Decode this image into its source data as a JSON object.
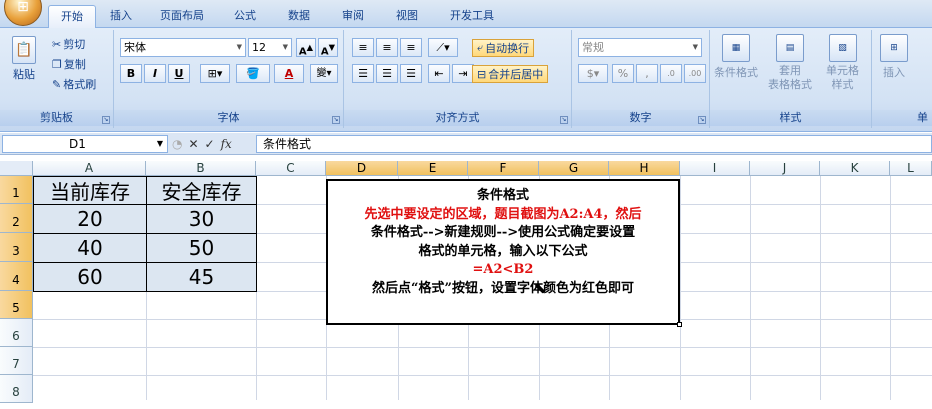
{
  "ribbon_tabs": [
    "开始",
    "插入",
    "页面布局",
    "公式",
    "数据",
    "审阅",
    "视图",
    "开发工具"
  ],
  "clipboard": {
    "paste": "粘贴",
    "cut": "剪切",
    "copy": "复制",
    "format_painter": "格式刷",
    "label": "剪贴板"
  },
  "font": {
    "name": "宋体",
    "size": "12",
    "bold": "B",
    "italic": "I",
    "underline": "U",
    "label": "字体"
  },
  "alignment": {
    "wrap": "自动换行",
    "merge": "合并后居中",
    "label": "对齐方式"
  },
  "number": {
    "format": "常规",
    "label": "数字"
  },
  "styles": {
    "conditional": "条件格式",
    "as_table": "套用\n表格格式",
    "cell_styles": "单元格\n样式",
    "label": "样式"
  },
  "cells": {
    "insert": "插入",
    "label": "单"
  },
  "formula_bar": {
    "name_box": "D1",
    "content": "条件格式",
    "fx": "fx"
  },
  "columns": [
    "A",
    "B",
    "C",
    "D",
    "E",
    "F",
    "G",
    "H",
    "I",
    "J",
    "K",
    "L"
  ],
  "rows": [
    "1",
    "2",
    "3",
    "4",
    "5",
    "6",
    "7",
    "8"
  ],
  "table": {
    "headers": [
      "当前库存",
      "安全库存"
    ],
    "rows": [
      [
        "20",
        "30"
      ],
      [
        "40",
        "50"
      ],
      [
        "60",
        "45"
      ]
    ]
  },
  "note": {
    "title": "条件格式",
    "line1": "先选中要设定的区域，题目截图为A2:A4，然后",
    "line2": "条件格式-->新建规则-->使用公式确定要设置",
    "line3": "格式的单元格，输入以下公式",
    "line4": "=A2<B2",
    "line5": "然后点“格式”按钮，设置字体颜色为红色即可"
  },
  "colors": {
    "accent_red": "#e01010",
    "table_fill": "#dce6f1",
    "selected_header": "#f1c15f"
  }
}
